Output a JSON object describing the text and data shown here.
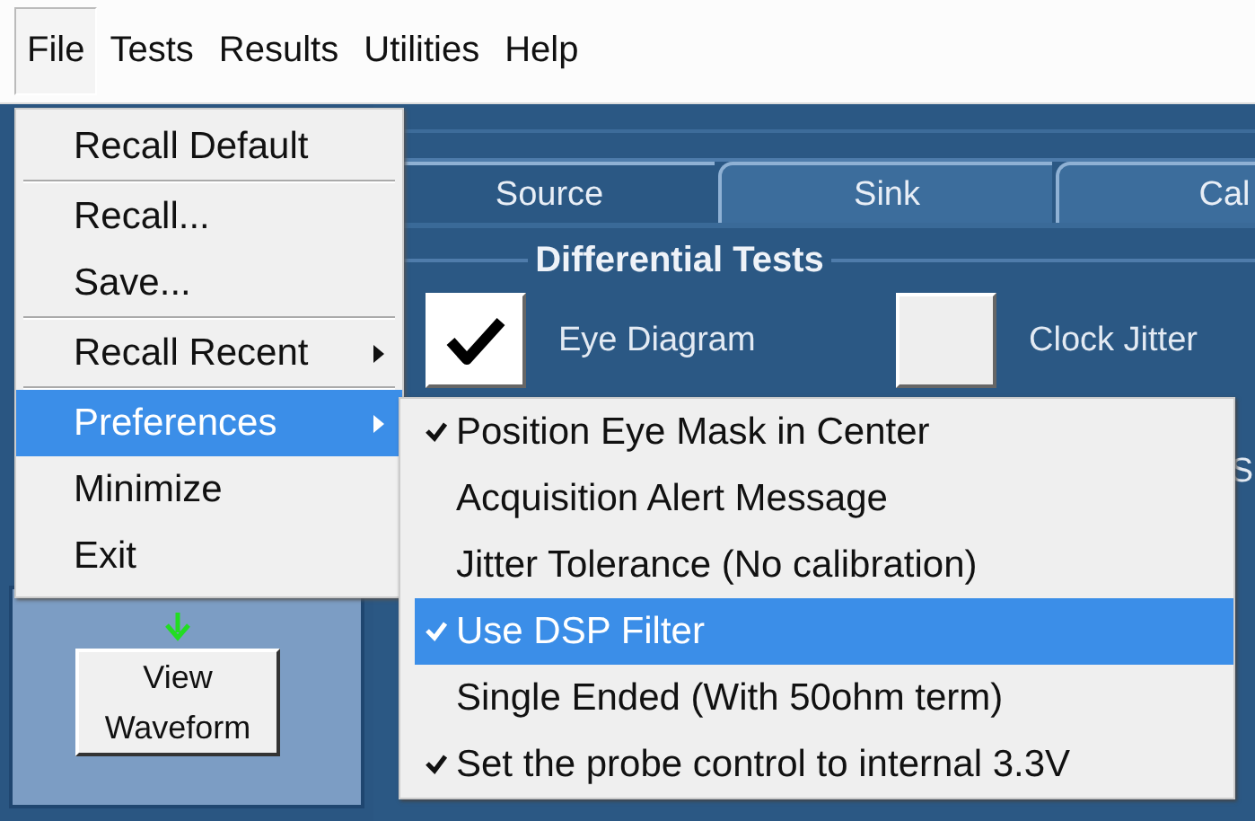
{
  "menubar": [
    {
      "label": "File",
      "selected": true
    },
    {
      "label": "Tests",
      "selected": false
    },
    {
      "label": "Results",
      "selected": false
    },
    {
      "label": "Utilities",
      "selected": false
    },
    {
      "label": "Help",
      "selected": false
    }
  ],
  "tabs": [
    {
      "label": "Source",
      "selected": true
    },
    {
      "label": "Sink",
      "selected": false
    },
    {
      "label": "Cal",
      "selected": false
    }
  ],
  "section_title": "Differential Tests",
  "tests": [
    {
      "label": "Eye Diagram",
      "checked": true
    },
    {
      "label": "Clock Jitter",
      "checked": false
    }
  ],
  "partial_label": "S",
  "view_waveform_button": "View\nWaveform",
  "file_menu": [
    {
      "kind": "item",
      "label": "Recall Default",
      "selected": false
    },
    {
      "kind": "separator"
    },
    {
      "kind": "item",
      "label": "Recall...",
      "selected": false
    },
    {
      "kind": "item",
      "label": "Save...",
      "selected": false
    },
    {
      "kind": "separator"
    },
    {
      "kind": "submenu",
      "label": "Recall Recent",
      "selected": false
    },
    {
      "kind": "separator"
    },
    {
      "kind": "submenu",
      "label": "Preferences",
      "selected": true
    },
    {
      "kind": "item",
      "label": "Minimize",
      "selected": false
    },
    {
      "kind": "item",
      "label": "Exit",
      "selected": false
    }
  ],
  "preferences_menu": [
    {
      "label": "Position Eye Mask in Center",
      "checked": true,
      "selected": false
    },
    {
      "label": "Acquisition Alert Message",
      "checked": false,
      "selected": false
    },
    {
      "label": "Jitter Tolerance (No calibration)",
      "checked": false,
      "selected": false
    },
    {
      "label": "Use DSP Filter",
      "checked": true,
      "selected": true
    },
    {
      "label": "Single Ended (With 50ohm term)",
      "checked": false,
      "selected": false
    },
    {
      "label": "Set the probe control to internal 3.3V",
      "checked": true,
      "selected": false
    }
  ]
}
